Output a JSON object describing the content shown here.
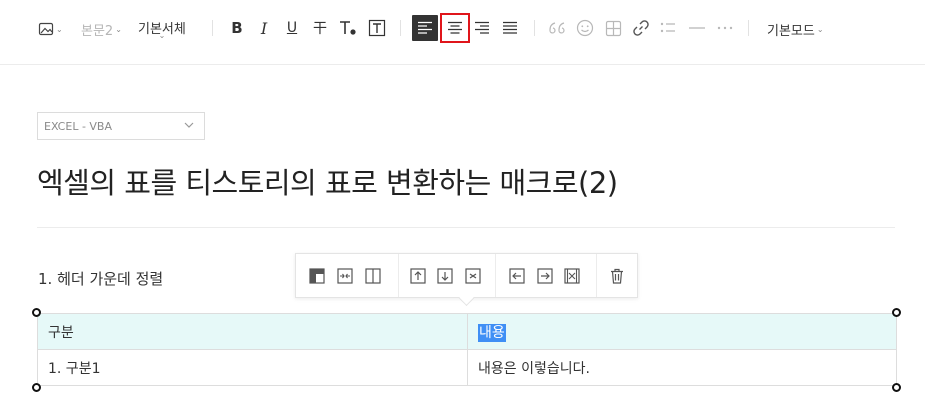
{
  "toolbar": {
    "image_icon": "image-icon",
    "paragraph_style": "본문2",
    "font_family": "기본서체",
    "bold_glyph": "B",
    "italic_glyph": "I",
    "underline_glyph": "U",
    "strike_glyph": "干",
    "mode": "기본모드"
  },
  "category": {
    "value": "EXCEL - VBA"
  },
  "post": {
    "title": "엑셀의 표를 티스토리의 표로 변환하는 매크로(2)",
    "paragraph": "1.  헤더 가운데 정렬"
  },
  "table": {
    "header": [
      "구분",
      "내용"
    ],
    "rows": [
      [
        "1. 구분1",
        "내용은 이렇습니다."
      ]
    ]
  },
  "colors": {
    "accent_selected": "#3f8ff5",
    "header_bg": "#e6f9f8",
    "highlight_outline": "#e0151b"
  }
}
